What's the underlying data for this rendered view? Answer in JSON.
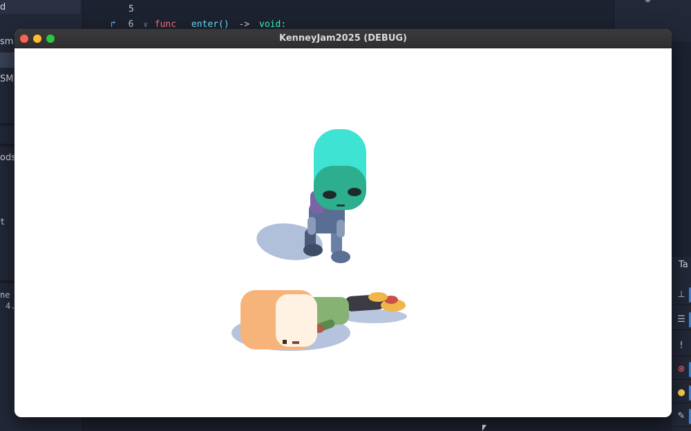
{
  "editor": {
    "left_panel": {
      "rows": [
        "d",
        "sm",
        "",
        "SM",
        "ods",
        "t",
        "ne",
        "4."
      ]
    },
    "code": {
      "line5_number": "5",
      "line6_number": "6",
      "line6_keyword": "func",
      "line6_name": "enter()",
      "line6_arrow": "->",
      "line6_type": "void:"
    },
    "dock": {
      "tab_label": "Ta"
    }
  },
  "game_window": {
    "title": "KenneyJam2025 (DEBUG)",
    "viewport_background": "#ffffff"
  },
  "scene": {
    "characters": [
      "alien-character-standing",
      "human-character-knocked-down"
    ]
  },
  "colors": {
    "alien_head": "#3fe3d4",
    "shadow": "#a8b9d6",
    "human_head": "#f7b47a"
  }
}
